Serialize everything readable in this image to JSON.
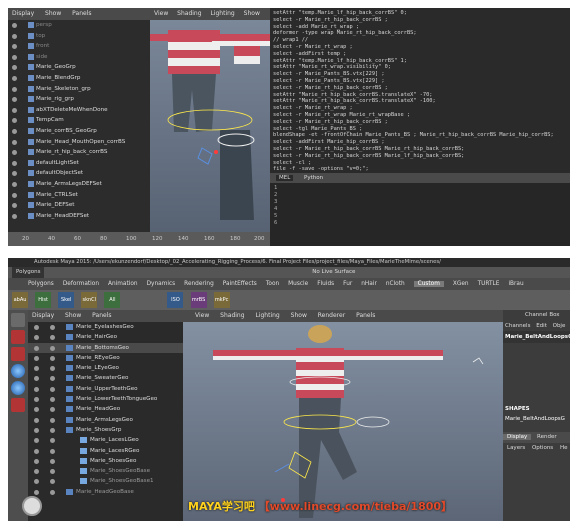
{
  "top": {
    "outliner": {
      "menu": [
        "Display",
        "Show",
        "Panels"
      ],
      "items": [
        {
          "label": "persp",
          "dim": true
        },
        {
          "label": "top",
          "dim": true
        },
        {
          "label": "front",
          "dim": true
        },
        {
          "label": "side",
          "dim": true
        },
        {
          "label": "Marie_GeoGrp"
        },
        {
          "label": "Marie_BlendGrp"
        },
        {
          "label": "Marie_Skeleton_grp"
        },
        {
          "label": "Marie_rig_grp"
        },
        {
          "label": "abXTDeleteMeWhenDone"
        },
        {
          "label": "TempCam"
        },
        {
          "label": "Marie_corrBS_GeoGrp"
        },
        {
          "label": "Marie_Head_MouthOpen_corrBS"
        },
        {
          "label": "Marie_rt_hip_back_corrBS"
        },
        {
          "label": "defaultLightSet"
        },
        {
          "label": "defaultObjectSet"
        },
        {
          "label": "Marie_ArmsLegsDEFSet"
        },
        {
          "label": "Marie_CTRLSet"
        },
        {
          "label": "Marie_DEFSet"
        },
        {
          "label": "Marie_HeadDEFSet"
        }
      ]
    },
    "ruler_ticks": [
      "20",
      "40",
      "60",
      "80",
      "100",
      "120",
      "140",
      "160",
      "180",
      "200"
    ],
    "viewport_menu": [
      "View",
      "Shading",
      "Lighting",
      "Show",
      "Renderer",
      "Panels"
    ],
    "script_lines": [
      "setAttr \"temp.Marie_lf_hip_back_corrBS\" 0;",
      "select -r Marie_rt_hip_back_corrBS ;",
      "select -add Marie_rt_wrap ;",
      "deformer -type wrap Marie_rt_hip_back_corrBS;",
      "// wrap1 //",
      "select -r Marie_rt_wrap ;",
      "select -addFirst temp ;",
      "setAttr \"temp.Marie_lf_hip_back_corrBS\" 1;",
      "setAttr \"Marie_rt_wrap.visibility\" 0;",
      "select -r Marie_Pants_BS.vtx[229] ;",
      "select -r Marie_Pants_BS.vtx[229] ;",
      "select -r Marie_rt_hip_back_corrBS ;",
      "setAttr \"Marie_rt_hip_back_corrBS.translateX\" -70;",
      "setAttr \"Marie_rt_hip_back_corrBS.translateX\" -100;",
      "select -r Marie_rt_wrap ;",
      "select -r Marie_rt_wrap Marie_rt_wrapBase ;",
      "select -r Marie_rt_hip_back_corrBS ;",
      "select -tgl Marie_Pants_BS ;",
      "blendShape -et -frontOfChain Marie_Pants_BS ; Marie_rt_hip_back_corrBS Marie_hip_corrBS;",
      "select -addFirst Marie_hip_corrBS ;",
      "select -r Marie_rt_hip_back_corrBS Marie_rt_hip_back_corrBS;",
      "select -r Marie_rt_hip_back_corrBS Marie_lf_hip_back_corrBS;",
      "select -cl ;",
      "file -f -save -options \"v=0;\";",
      "// C:/Users/ekunzendorf/Desktop/_02_Accelerating_Rigging_Process/6. Final Project Files/pro"
    ],
    "script_tabs": [
      "MEL",
      "Python"
    ],
    "input_lines": [
      "1",
      "2",
      "3",
      "4",
      "5",
      "6"
    ]
  },
  "bottom": {
    "title": "Autodesk Maya 2015: /Users/ekunzendorf/Desktop/_02_Accelerating_Rigging_Process/6. Final Project Files/project_files/Maya_Files/MarieTheMime/scenes/",
    "mode": "Polygons",
    "no_live_surface": "No Live Surface",
    "shelf_tabs": [
      "Polygons",
      "Deformation",
      "Animation",
      "Dynamics",
      "Rendering",
      "PaintEffects",
      "Toon",
      "Muscle",
      "Fluids",
      "Fur",
      "nHair",
      "nCloth",
      "Custom",
      "XGen",
      "TURTLE",
      "iBrau"
    ],
    "active_shelf_tab": "Custom",
    "shelf_icons": [
      "abAu",
      "Hist",
      "Skel",
      "sknCl",
      "All",
      "ISO",
      "mrBS",
      "mkPc"
    ],
    "outliner_menu": [
      "Display",
      "Show",
      "Panels"
    ],
    "outliner_items": [
      {
        "label": "Marie_EyelashesGeo",
        "kind": "item"
      },
      {
        "label": "Marie_HairGeo",
        "kind": "item"
      },
      {
        "label": "Marie_BottomsGeo",
        "kind": "sel"
      },
      {
        "label": "Marie_REyeGeo",
        "kind": "item"
      },
      {
        "label": "Marie_LEyeGeo",
        "kind": "item"
      },
      {
        "label": "Marie_SweaterGeo",
        "kind": "item"
      },
      {
        "label": "Marie_UpperTeethGeo",
        "kind": "item"
      },
      {
        "label": "Marie_LowerTeethTongueGeo",
        "kind": "item"
      },
      {
        "label": "Marie_HeadGeo",
        "kind": "item"
      },
      {
        "label": "Marie_ArmsLegsGeo",
        "kind": "item"
      },
      {
        "label": "Marie_ShoesGrp",
        "kind": "item"
      },
      {
        "label": "Marie_LacesLGeo",
        "kind": "sub"
      },
      {
        "label": "Marie_LacesRGeo",
        "kind": "sub"
      },
      {
        "label": "Marie_ShoesGeo",
        "kind": "sub"
      },
      {
        "label": "Marie_ShoesGeoBase",
        "kind": "subdim"
      },
      {
        "label": "Marie_ShoesGeoBase1",
        "kind": "subdim"
      },
      {
        "label": "Marie_HeadGeoBase",
        "kind": "dim"
      }
    ],
    "viewport_menu": [
      "View",
      "Shading",
      "Lighting",
      "Show",
      "Renderer",
      "Panels"
    ],
    "channel_box": {
      "title": "Channel Box",
      "menu": [
        "Channels",
        "Edit",
        "Obje"
      ],
      "object": "Marie_BeltAndLoopsGe",
      "shapes_label": "SHAPES",
      "shape_name": "Marie_BeltAndLoopsG",
      "tabs": [
        "Display",
        "Render"
      ],
      "active_tab": "Display",
      "sub_menu": [
        "Layers",
        "Options",
        "He"
      ]
    },
    "watermark": {
      "brand": "MAYA学习吧",
      "url": "【www.linecg.com/tieba/1800】"
    }
  }
}
